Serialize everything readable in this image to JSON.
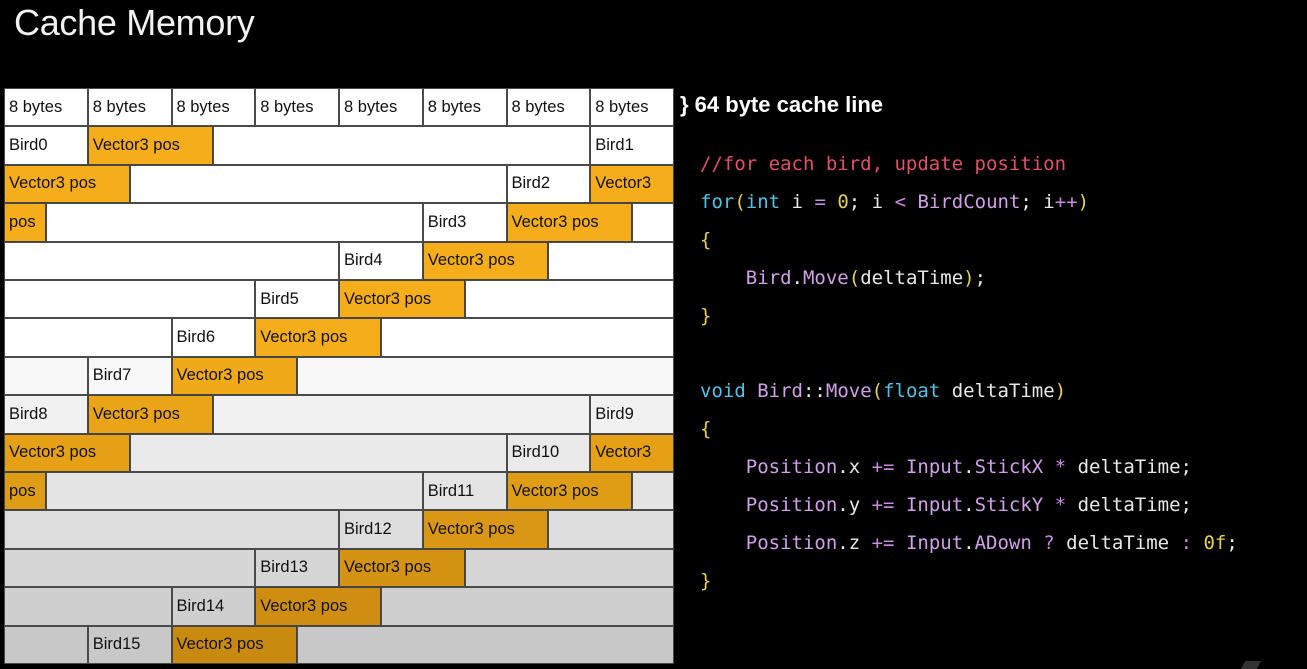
{
  "title": "Cache Memory",
  "cache_line_label": "} 64 byte cache line",
  "header_cells": [
    "8 bytes",
    "8 bytes",
    "8 bytes",
    "8 bytes",
    "8 bytes",
    "8 bytes",
    "8 bytes",
    "8 bytes"
  ],
  "rows": [
    [
      {
        "text": "Bird0",
        "kind": "bird",
        "col": 0,
        "span": 1
      },
      {
        "text": "Vector3 pos",
        "kind": "vec",
        "col": 1,
        "span": 1.5
      },
      {
        "text": "",
        "kind": "empty",
        "col": 2.5,
        "span": 4.5
      },
      {
        "text": "Bird1",
        "kind": "bird",
        "col": 7,
        "span": 1
      }
    ],
    [
      {
        "text": "Vector3 pos",
        "kind": "vec",
        "col": 0,
        "span": 1.5
      },
      {
        "text": "",
        "kind": "empty",
        "col": 1.5,
        "span": 4.5
      },
      {
        "text": "Bird2",
        "kind": "bird",
        "col": 6,
        "span": 1
      },
      {
        "text": "Vector3",
        "kind": "vec",
        "col": 7,
        "span": 1
      }
    ],
    [
      {
        "text": "pos",
        "kind": "vec",
        "col": 0,
        "span": 0.5
      },
      {
        "text": "",
        "kind": "empty",
        "col": 0.5,
        "span": 4.5
      },
      {
        "text": "Bird3",
        "kind": "bird",
        "col": 5,
        "span": 1
      },
      {
        "text": "Vector3 pos",
        "kind": "vec",
        "col": 6,
        "span": 1.5
      },
      {
        "text": "",
        "kind": "empty",
        "col": 7.5,
        "span": 0.5
      }
    ],
    [
      {
        "text": "",
        "kind": "empty",
        "col": 0,
        "span": 4
      },
      {
        "text": "Bird4",
        "kind": "bird",
        "col": 4,
        "span": 1
      },
      {
        "text": "Vector3 pos",
        "kind": "vec",
        "col": 5,
        "span": 1.5
      },
      {
        "text": "",
        "kind": "empty",
        "col": 6.5,
        "span": 1.5
      }
    ],
    [
      {
        "text": "",
        "kind": "empty",
        "col": 0,
        "span": 3
      },
      {
        "text": "Bird5",
        "kind": "bird",
        "col": 3,
        "span": 1
      },
      {
        "text": "Vector3 pos",
        "kind": "vec",
        "col": 4,
        "span": 1.5
      },
      {
        "text": "",
        "kind": "empty",
        "col": 5.5,
        "span": 2.5
      }
    ],
    [
      {
        "text": "",
        "kind": "empty",
        "col": 0,
        "span": 2
      },
      {
        "text": "Bird6",
        "kind": "bird",
        "col": 2,
        "span": 1
      },
      {
        "text": "Vector3 pos",
        "kind": "vec",
        "col": 3,
        "span": 1.5
      },
      {
        "text": "",
        "kind": "empty",
        "col": 4.5,
        "span": 3.5
      }
    ],
    [
      {
        "text": "",
        "kind": "empty",
        "col": 0,
        "span": 1
      },
      {
        "text": "Bird7",
        "kind": "bird",
        "col": 1,
        "span": 1
      },
      {
        "text": "Vector3 pos",
        "kind": "vec",
        "col": 2,
        "span": 1.5
      },
      {
        "text": "",
        "kind": "empty",
        "col": 3.5,
        "span": 4.5
      }
    ],
    [
      {
        "text": "Bird8",
        "kind": "bird",
        "col": 0,
        "span": 1
      },
      {
        "text": "Vector3 pos",
        "kind": "vec",
        "col": 1,
        "span": 1.5
      },
      {
        "text": "",
        "kind": "empty",
        "col": 2.5,
        "span": 4.5
      },
      {
        "text": "Bird9",
        "kind": "bird",
        "col": 7,
        "span": 1
      }
    ],
    [
      {
        "text": "Vector3 pos",
        "kind": "vec",
        "col": 0,
        "span": 1.5
      },
      {
        "text": "",
        "kind": "empty",
        "col": 1.5,
        "span": 4.5
      },
      {
        "text": "Bird10",
        "kind": "bird",
        "col": 6,
        "span": 1
      },
      {
        "text": "Vector3",
        "kind": "vec",
        "col": 7,
        "span": 1
      }
    ],
    [
      {
        "text": "pos",
        "kind": "vec",
        "col": 0,
        "span": 0.5
      },
      {
        "text": "",
        "kind": "empty",
        "col": 0.5,
        "span": 4.5
      },
      {
        "text": "Bird11",
        "kind": "bird",
        "col": 5,
        "span": 1
      },
      {
        "text": "Vector3 pos",
        "kind": "vec",
        "col": 6,
        "span": 1.5
      },
      {
        "text": "",
        "kind": "empty",
        "col": 7.5,
        "span": 0.5
      }
    ],
    [
      {
        "text": "",
        "kind": "empty",
        "col": 0,
        "span": 4
      },
      {
        "text": "Bird12",
        "kind": "bird",
        "col": 4,
        "span": 1
      },
      {
        "text": "Vector3 pos",
        "kind": "vec",
        "col": 5,
        "span": 1.5
      },
      {
        "text": "",
        "kind": "empty",
        "col": 6.5,
        "span": 1.5
      }
    ],
    [
      {
        "text": "",
        "kind": "empty",
        "col": 0,
        "span": 3
      },
      {
        "text": "Bird13",
        "kind": "bird",
        "col": 3,
        "span": 1
      },
      {
        "text": "Vector3 pos",
        "kind": "vec",
        "col": 4,
        "span": 1.5
      },
      {
        "text": "",
        "kind": "empty",
        "col": 5.5,
        "span": 2.5
      }
    ],
    [
      {
        "text": "",
        "kind": "empty",
        "col": 0,
        "span": 2
      },
      {
        "text": "Bird14",
        "kind": "bird",
        "col": 2,
        "span": 1
      },
      {
        "text": "Vector3 pos",
        "kind": "vec",
        "col": 3,
        "span": 1.5
      },
      {
        "text": "",
        "kind": "empty",
        "col": 4.5,
        "span": 3.5
      }
    ],
    [
      {
        "text": "",
        "kind": "empty",
        "col": 0,
        "span": 1
      },
      {
        "text": "Bird15",
        "kind": "bird",
        "col": 1,
        "span": 1
      },
      {
        "text": "Vector3 pos",
        "kind": "vec",
        "col": 2,
        "span": 1.5
      },
      {
        "text": "",
        "kind": "empty",
        "col": 3.5,
        "span": 4.5
      }
    ]
  ],
  "code_lines": [
    [
      {
        "t": "//for each bird, update position",
        "c": "comment"
      }
    ],
    [
      {
        "t": "for",
        "c": "kw"
      },
      {
        "t": "(",
        "c": "yellow"
      },
      {
        "t": "int",
        "c": "kw"
      },
      {
        "t": " i ",
        "c": "ident"
      },
      {
        "t": "=",
        "c": "op"
      },
      {
        "t": " ",
        "c": "ident"
      },
      {
        "t": "0",
        "c": "num"
      },
      {
        "t": "; i ",
        "c": "ident"
      },
      {
        "t": "<",
        "c": "op"
      },
      {
        "t": " ",
        "c": "ident"
      },
      {
        "t": "BirdCount",
        "c": "pink"
      },
      {
        "t": "; i",
        "c": "ident"
      },
      {
        "t": "++",
        "c": "op"
      },
      {
        "t": ")",
        "c": "yellow"
      }
    ],
    [
      {
        "t": "{",
        "c": "yellow"
      }
    ],
    [
      {
        "t": "    ",
        "c": "ident"
      },
      {
        "t": "Bird",
        "c": "pink"
      },
      {
        "t": ".",
        "c": "ident"
      },
      {
        "t": "Move",
        "c": "pink"
      },
      {
        "t": "(",
        "c": "yellow"
      },
      {
        "t": "deltaTime",
        "c": "ident"
      },
      {
        "t": ")",
        "c": "yellow"
      },
      {
        "t": ";",
        "c": "ident"
      }
    ],
    [
      {
        "t": "}",
        "c": "yellow"
      }
    ],
    [
      {
        "t": "",
        "c": "ident"
      }
    ],
    [
      {
        "t": "void",
        "c": "kw"
      },
      {
        "t": " ",
        "c": "ident"
      },
      {
        "t": "Bird",
        "c": "pink"
      },
      {
        "t": "::",
        "c": "ident"
      },
      {
        "t": "Move",
        "c": "pink"
      },
      {
        "t": "(",
        "c": "yellow"
      },
      {
        "t": "float",
        "c": "kw"
      },
      {
        "t": " deltaTime",
        "c": "ident"
      },
      {
        "t": ")",
        "c": "yellow"
      }
    ],
    [
      {
        "t": "{",
        "c": "yellow"
      }
    ],
    [
      {
        "t": "    ",
        "c": "ident"
      },
      {
        "t": "Position",
        "c": "pink"
      },
      {
        "t": ".x ",
        "c": "ident"
      },
      {
        "t": "+=",
        "c": "op"
      },
      {
        "t": " ",
        "c": "ident"
      },
      {
        "t": "Input",
        "c": "pink"
      },
      {
        "t": ".",
        "c": "ident"
      },
      {
        "t": "StickX",
        "c": "pink"
      },
      {
        "t": " ",
        "c": "ident"
      },
      {
        "t": "*",
        "c": "op"
      },
      {
        "t": " deltaTime;",
        "c": "ident"
      }
    ],
    [
      {
        "t": "    ",
        "c": "ident"
      },
      {
        "t": "Position",
        "c": "pink"
      },
      {
        "t": ".y ",
        "c": "ident"
      },
      {
        "t": "+=",
        "c": "op"
      },
      {
        "t": " ",
        "c": "ident"
      },
      {
        "t": "Input",
        "c": "pink"
      },
      {
        "t": ".",
        "c": "ident"
      },
      {
        "t": "StickY",
        "c": "pink"
      },
      {
        "t": " ",
        "c": "ident"
      },
      {
        "t": "*",
        "c": "op"
      },
      {
        "t": " deltaTime;",
        "c": "ident"
      }
    ],
    [
      {
        "t": "    ",
        "c": "ident"
      },
      {
        "t": "Position",
        "c": "pink"
      },
      {
        "t": ".z ",
        "c": "ident"
      },
      {
        "t": "+=",
        "c": "op"
      },
      {
        "t": " ",
        "c": "ident"
      },
      {
        "t": "Input",
        "c": "pink"
      },
      {
        "t": ".",
        "c": "ident"
      },
      {
        "t": "ADown",
        "c": "pink"
      },
      {
        "t": " ",
        "c": "ident"
      },
      {
        "t": "?",
        "c": "op"
      },
      {
        "t": " deltaTime ",
        "c": "ident"
      },
      {
        "t": ":",
        "c": "op"
      },
      {
        "t": " ",
        "c": "ident"
      },
      {
        "t": "0f",
        "c": "num"
      },
      {
        "t": ";",
        "c": "ident"
      }
    ],
    [
      {
        "t": "}",
        "c": "yellow"
      }
    ]
  ],
  "colors": {
    "vector_fill": "#f5ad1a",
    "row_fill_light": "#ffffff",
    "row_fill_dark": "#c8c8c8",
    "background": "#000000"
  }
}
